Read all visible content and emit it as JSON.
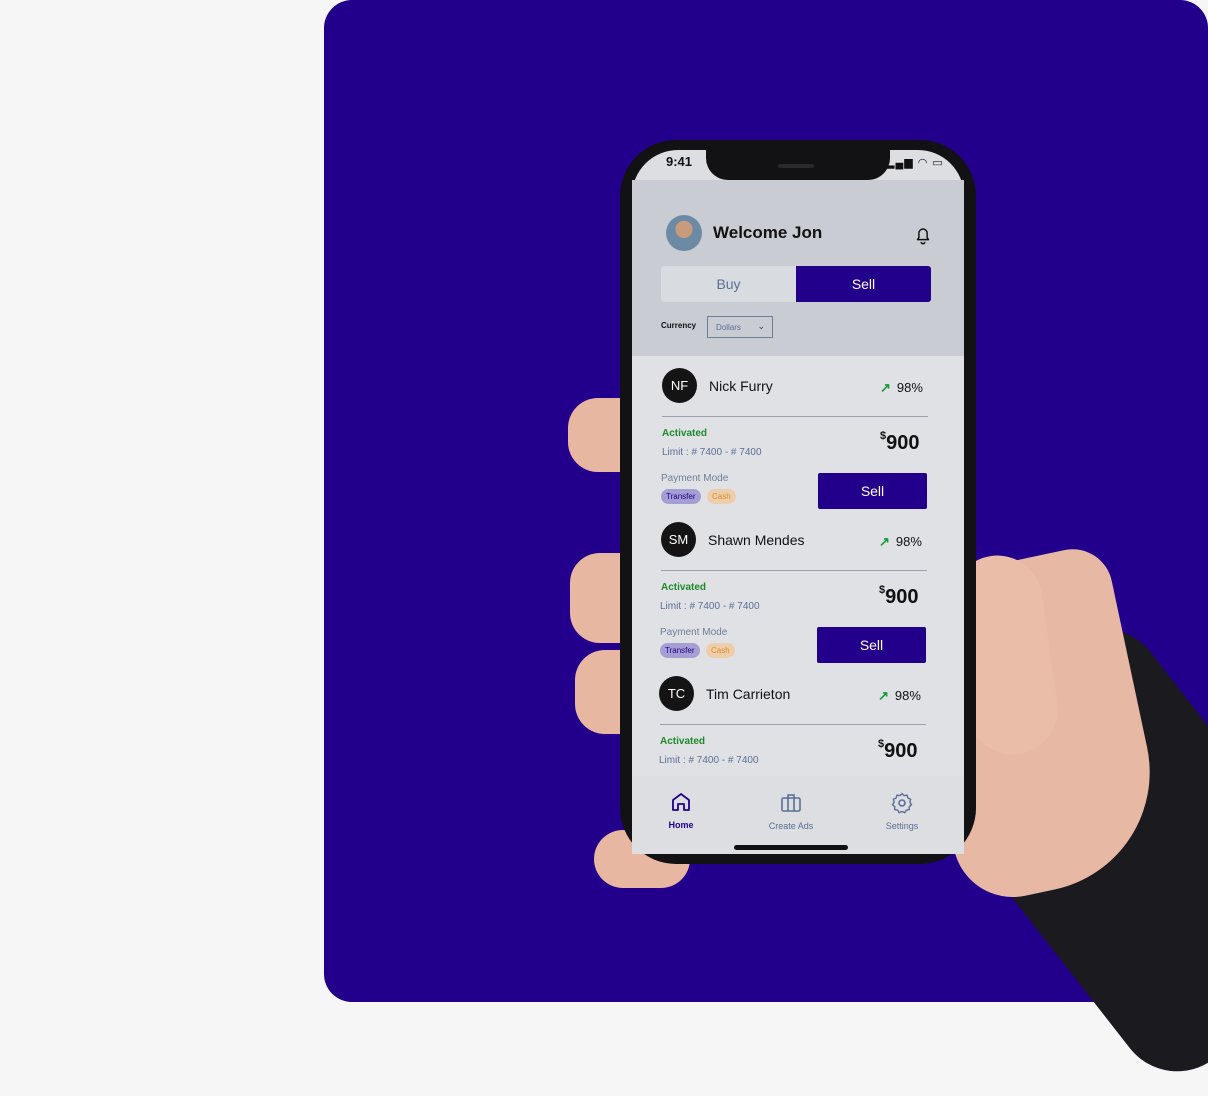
{
  "status_bar": {
    "time": "9:41",
    "icons": "▂▄▆ ◠ ▭"
  },
  "header": {
    "welcome": "Welcome Jon"
  },
  "tabs": {
    "buy": "Buy",
    "sell": "Sell"
  },
  "currency": {
    "label": "Currency",
    "value": "Dollars"
  },
  "traders": [
    {
      "initials": "NF",
      "name": "Nick Furry",
      "trend": "98%",
      "status": "Activated",
      "limit": "Limit : # 7400 - # 7400",
      "currency_symbol": "$",
      "amount": "900",
      "payment_mode_label": "Payment Mode",
      "tags": [
        "Transfer",
        "Cash"
      ],
      "action": "Sell"
    },
    {
      "initials": "SM",
      "name": "Shawn Mendes",
      "trend": "98%",
      "status": "Activated",
      "limit": "Limit : # 7400 - # 7400",
      "currency_symbol": "$",
      "amount": "900",
      "payment_mode_label": "Payment Mode",
      "tags": [
        "Transfer",
        "Cash"
      ],
      "action": "Sell"
    },
    {
      "initials": "TC",
      "name": "Tim Carrieton",
      "trend": "98%",
      "status": "Activated",
      "limit": "Limit : # 7400 - # 7400",
      "currency_symbol": "$",
      "amount": "900"
    }
  ],
  "bottom_nav": [
    {
      "label": "Home",
      "icon": "home-icon",
      "active": true
    },
    {
      "label": "Create Ads",
      "icon": "briefcase-icon",
      "active": false
    },
    {
      "label": "Settings",
      "icon": "gear-icon",
      "active": false
    }
  ],
  "colors": {
    "brand": "#22008b",
    "background": "#f6f6f6",
    "success": "#1e8a2a",
    "tag_cash": "#d58d2a"
  }
}
